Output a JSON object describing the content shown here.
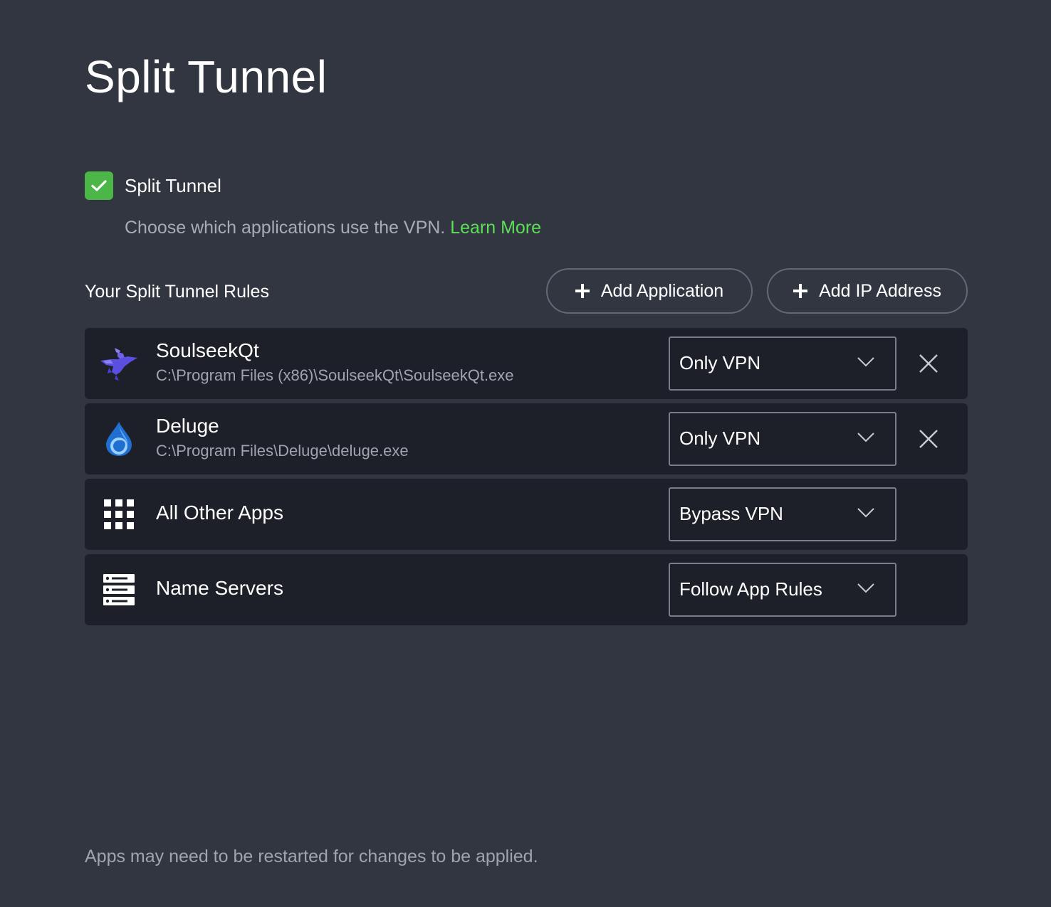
{
  "page": {
    "title": "Split Tunnel"
  },
  "toggle": {
    "label": "Split Tunnel",
    "checked": true,
    "description": "Choose which applications use the VPN.",
    "learn_more": "Learn More"
  },
  "rules": {
    "heading": "Your Split Tunnel Rules",
    "add_application_label": "Add Application",
    "add_ip_label": "Add IP Address",
    "items": [
      {
        "name": "SoulseekQt",
        "path": "C:\\Program Files (x86)\\SoulseekQt\\SoulseekQt.exe",
        "mode": "Only VPN",
        "icon": "soulseek-bird-icon",
        "removable": true
      },
      {
        "name": "Deluge",
        "path": "C:\\Program Files\\Deluge\\deluge.exe",
        "mode": "Only VPN",
        "icon": "deluge-drop-icon",
        "removable": true
      },
      {
        "name": "All Other Apps",
        "mode": "Bypass VPN",
        "icon": "app-grid-icon",
        "removable": false
      },
      {
        "name": "Name Servers",
        "mode": "Follow App Rules",
        "icon": "server-rack-icon",
        "removable": false
      }
    ]
  },
  "footer": {
    "note": "Apps may need to be restarted for changes to be applied."
  },
  "colors": {
    "background": "#323641",
    "row_background": "#1d2029",
    "accent_green": "#4cb649",
    "link_green": "#5ddf57",
    "muted_text": "#a0a4ae"
  }
}
